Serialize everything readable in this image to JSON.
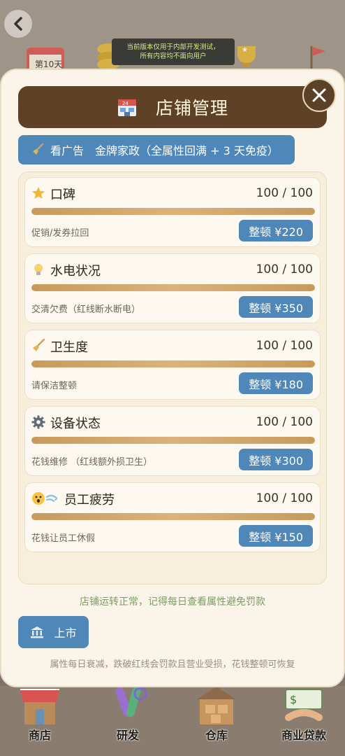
{
  "test_notice": {
    "line1": "当前版本仅用于内部开发测试，",
    "line2": "所有内容均不面向用户"
  },
  "bg": {
    "calendar_text": "第10天"
  },
  "modal": {
    "title": "店铺管理",
    "close_icon": "close-icon",
    "ad_button": "看广告　金牌家政（全属性回满 + 3 天免疫）",
    "attributes": [
      {
        "icon": "star-icon",
        "name": "口碑",
        "value": "100 / 100",
        "level": 1.0,
        "desc": "促销/发券拉回",
        "action": "整顿 ¥220"
      },
      {
        "icon": "lightbulb-icon",
        "name": "水电状况",
        "value": "100 / 100",
        "level": 1.0,
        "desc": "交清欠费（红线断水断电）",
        "action": "整顿 ¥350"
      },
      {
        "icon": "broom-icon",
        "name": "卫生度",
        "value": "100 / 100",
        "level": 1.0,
        "desc": "请保洁整顿",
        "action": "整顿 ¥180"
      },
      {
        "icon": "gear-icon",
        "name": "设备状态",
        "value": "100 / 100",
        "level": 1.0,
        "desc": "花钱维修 （红线额外损卫生）",
        "action": "整顿 ¥300"
      },
      {
        "icon": "tired-face-icon",
        "name": "员工疲劳",
        "value": "100 / 100",
        "level": 1.0,
        "desc": "花钱让员工休假",
        "action": "整顿 ¥150"
      }
    ],
    "status": "店铺运转正常，记得每日查看属性避免罚款",
    "ipo_button": "上市",
    "footer": "属性每日衰减，跌破红线会罚款且营业受损，花钱整顿可恢复"
  },
  "bottom_nav": [
    {
      "label": "商店",
      "icon": "shop-icon"
    },
    {
      "label": "研发",
      "icon": "test-tube-icon"
    },
    {
      "label": "仓库",
      "icon": "warehouse-icon"
    },
    {
      "label": "商业贷款",
      "icon": "loan-icon"
    }
  ],
  "colors": {
    "accent_blue": "#4f87b9",
    "title_brown": "#5e4126",
    "modal_bg": "#fbf5e9",
    "bar_gold": "#d1a66a"
  }
}
